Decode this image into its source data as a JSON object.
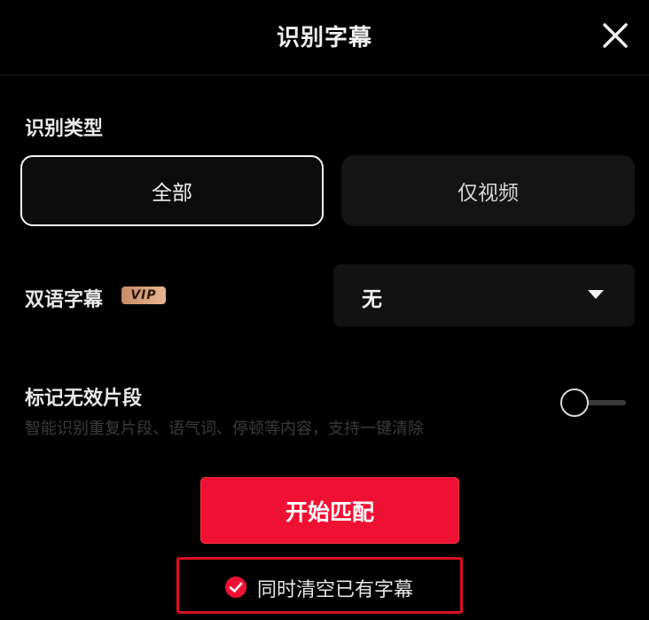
{
  "header": {
    "title": "识别字幕",
    "close_icon": "close-icon"
  },
  "recognition_type": {
    "label": "识别类型",
    "options": [
      {
        "label": "全部",
        "selected": true
      },
      {
        "label": "仅视频",
        "selected": false
      }
    ]
  },
  "bilingual": {
    "label": "双语字幕",
    "badge": "VIP",
    "badge_color": "#d9a07c",
    "selected_value": "无",
    "dropdown_icon": "caret-down-icon"
  },
  "invalid_segments": {
    "label": "标记无效片段",
    "description": "智能识别重复片段、语气词、停顿等内容，支持一键清除",
    "enabled": false
  },
  "start_button": {
    "label": "开始匹配",
    "color": "#ee1133"
  },
  "clear_existing": {
    "label": "同时清空已有字幕",
    "checked": true,
    "check_icon": "check-circle-icon",
    "highlight_color": "#d8101f"
  }
}
